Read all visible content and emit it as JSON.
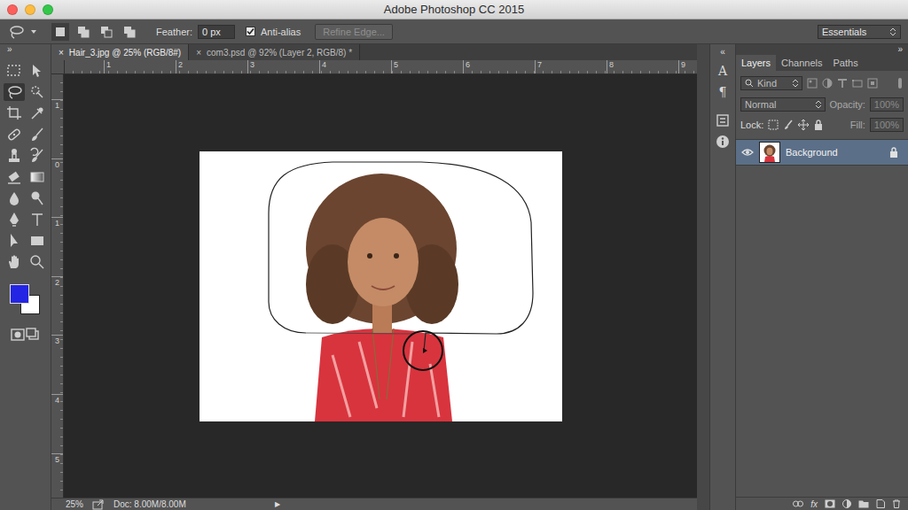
{
  "window": {
    "title": "Adobe Photoshop CC 2015"
  },
  "options_bar": {
    "feather_label": "Feather:",
    "feather_value": "0 px",
    "anti_alias": {
      "label": "Anti-alias",
      "checked": true
    },
    "refine_edge": {
      "label": "Refine Edge...",
      "disabled": true
    },
    "workspace": "Essentials"
  },
  "document_tabs": [
    {
      "close": "×",
      "label": "Hair_3.jpg @ 25% (RGB/8#)",
      "selected": true
    },
    {
      "close": "×",
      "label": "com3.psd @ 92% (Layer 2, RGB/8) *",
      "selected": false
    }
  ],
  "rulers": {
    "horizontal": [
      "1",
      "2",
      "3",
      "4",
      "5",
      "6",
      "7",
      "8",
      "9"
    ],
    "vertical": [
      "1",
      "0",
      "1",
      "2",
      "3",
      "4",
      "5"
    ]
  },
  "toolbar": {
    "collapse": "»",
    "tools": [
      {
        "selected": false
      },
      {
        "selected": false
      },
      {
        "selected": true
      },
      {
        "selected": false
      },
      {
        "selected": false
      },
      {
        "selected": false
      },
      {
        "selected": false
      },
      {
        "selected": false
      },
      {
        "selected": false
      },
      {
        "selected": false
      },
      {
        "selected": false
      },
      {
        "selected": false
      },
      {
        "selected": false
      },
      {
        "selected": false
      },
      {
        "selected": false
      },
      {
        "selected": false
      },
      {
        "selected": false
      },
      {
        "selected": false
      },
      {
        "selected": false
      },
      {
        "selected": false
      }
    ],
    "foreground_color": "#2424e4",
    "background_color": "#ffffff"
  },
  "side_strip": {
    "collapse": "«",
    "items": [
      "A",
      "¶"
    ]
  },
  "panel": {
    "collapse": "»",
    "tabs": [
      {
        "label": "Layers",
        "selected": true
      },
      {
        "label": "Channels",
        "selected": false
      },
      {
        "label": "Paths",
        "selected": false
      }
    ],
    "filter": "Kind",
    "blend_mode": "Normal",
    "opacity": {
      "label": "Opacity:",
      "value": "100%",
      "disabled": true
    },
    "lock_label": "Lock:",
    "fill": {
      "label": "Fill:",
      "value": "100%",
      "disabled": true
    },
    "layers": [
      {
        "name": "Background",
        "visible": true,
        "selected": true,
        "locked": true
      }
    ],
    "footer_fx": "fx"
  },
  "status_bar": {
    "zoom": "25%",
    "doc": "Doc: 8.00M/8.00M",
    "arrow": "▶"
  }
}
